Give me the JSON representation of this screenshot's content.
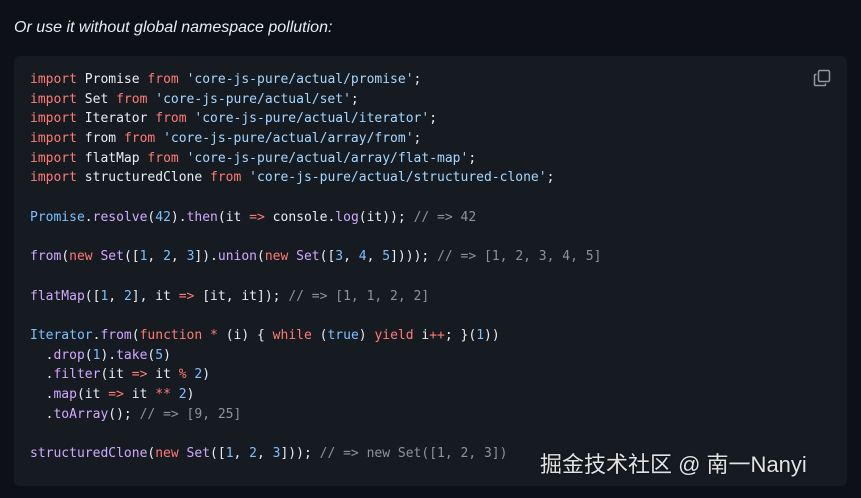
{
  "intro": "Or use it without global namespace pollution:",
  "copy_icon": "copy-icon",
  "colors": {
    "background": "#0d1117",
    "code_background": "#161b22",
    "keyword": "#ff7b72",
    "string": "#a5d6ff",
    "function": "#d2a8ff",
    "constant": "#79c0ff",
    "comment": "#8b949e",
    "text": "#e6edf3"
  },
  "code_lines": [
    [
      [
        "kw",
        "import"
      ],
      [
        "p",
        " Promise "
      ],
      [
        "kw",
        "from"
      ],
      [
        "p",
        " "
      ],
      [
        "str",
        "'core-js-pure/actual/promise'"
      ],
      [
        "p",
        ";"
      ]
    ],
    [
      [
        "kw",
        "import"
      ],
      [
        "p",
        " Set "
      ],
      [
        "kw",
        "from"
      ],
      [
        "p",
        " "
      ],
      [
        "str",
        "'core-js-pure/actual/set'"
      ],
      [
        "p",
        ";"
      ]
    ],
    [
      [
        "kw",
        "import"
      ],
      [
        "p",
        " Iterator "
      ],
      [
        "kw",
        "from"
      ],
      [
        "p",
        " "
      ],
      [
        "str",
        "'core-js-pure/actual/iterator'"
      ],
      [
        "p",
        ";"
      ]
    ],
    [
      [
        "kw",
        "import"
      ],
      [
        "p",
        " from "
      ],
      [
        "kw",
        "from"
      ],
      [
        "p",
        " "
      ],
      [
        "str",
        "'core-js-pure/actual/array/from'"
      ],
      [
        "p",
        ";"
      ]
    ],
    [
      [
        "kw",
        "import"
      ],
      [
        "p",
        " flatMap "
      ],
      [
        "kw",
        "from"
      ],
      [
        "p",
        " "
      ],
      [
        "str",
        "'core-js-pure/actual/array/flat-map'"
      ],
      [
        "p",
        ";"
      ]
    ],
    [
      [
        "kw",
        "import"
      ],
      [
        "p",
        " structuredClone "
      ],
      [
        "kw",
        "from"
      ],
      [
        "p",
        " "
      ],
      [
        "str",
        "'core-js-pure/actual/structured-clone'"
      ],
      [
        "p",
        ";"
      ]
    ],
    [],
    [
      [
        "const",
        "Promise"
      ],
      [
        "p",
        "."
      ],
      [
        "fn",
        "resolve"
      ],
      [
        "p",
        "("
      ],
      [
        "const",
        "42"
      ],
      [
        "p",
        ")."
      ],
      [
        "fn",
        "then"
      ],
      [
        "p",
        "(it "
      ],
      [
        "kw",
        "=>"
      ],
      [
        "p",
        " console."
      ],
      [
        "fn",
        "log"
      ],
      [
        "p",
        "(it)); "
      ],
      [
        "cm",
        "// => 42"
      ]
    ],
    [],
    [
      [
        "fn",
        "from"
      ],
      [
        "p",
        "("
      ],
      [
        "kw",
        "new"
      ],
      [
        "p",
        " "
      ],
      [
        "fn",
        "Set"
      ],
      [
        "p",
        "(["
      ],
      [
        "const",
        "1"
      ],
      [
        "p",
        ", "
      ],
      [
        "const",
        "2"
      ],
      [
        "p",
        ", "
      ],
      [
        "const",
        "3"
      ],
      [
        "p",
        "])."
      ],
      [
        "fn",
        "union"
      ],
      [
        "p",
        "("
      ],
      [
        "kw",
        "new"
      ],
      [
        "p",
        " "
      ],
      [
        "fn",
        "Set"
      ],
      [
        "p",
        "(["
      ],
      [
        "const",
        "3"
      ],
      [
        "p",
        ", "
      ],
      [
        "const",
        "4"
      ],
      [
        "p",
        ", "
      ],
      [
        "const",
        "5"
      ],
      [
        "p",
        "]))); "
      ],
      [
        "cm",
        "// => [1, 2, 3, 4, 5]"
      ]
    ],
    [],
    [
      [
        "fn",
        "flatMap"
      ],
      [
        "p",
        "(["
      ],
      [
        "const",
        "1"
      ],
      [
        "p",
        ", "
      ],
      [
        "const",
        "2"
      ],
      [
        "p",
        "], it "
      ],
      [
        "kw",
        "=>"
      ],
      [
        "p",
        " [it, it]); "
      ],
      [
        "cm",
        "// => [1, 1, 2, 2]"
      ]
    ],
    [],
    [
      [
        "const",
        "Iterator"
      ],
      [
        "p",
        "."
      ],
      [
        "fn",
        "from"
      ],
      [
        "p",
        "("
      ],
      [
        "kw",
        "function"
      ],
      [
        "p",
        " "
      ],
      [
        "kw",
        "*"
      ],
      [
        "p",
        " (i) { "
      ],
      [
        "kw",
        "while"
      ],
      [
        "p",
        " ("
      ],
      [
        "const",
        "true"
      ],
      [
        "p",
        ") "
      ],
      [
        "kw",
        "yield"
      ],
      [
        "p",
        " i"
      ],
      [
        "kw",
        "++"
      ],
      [
        "p",
        "; }("
      ],
      [
        "const",
        "1"
      ],
      [
        "p",
        "))"
      ]
    ],
    [
      [
        "p",
        "  ."
      ],
      [
        "fn",
        "drop"
      ],
      [
        "p",
        "("
      ],
      [
        "const",
        "1"
      ],
      [
        "p",
        ")."
      ],
      [
        "fn",
        "take"
      ],
      [
        "p",
        "("
      ],
      [
        "const",
        "5"
      ],
      [
        "p",
        ")"
      ]
    ],
    [
      [
        "p",
        "  ."
      ],
      [
        "fn",
        "filter"
      ],
      [
        "p",
        "(it "
      ],
      [
        "kw",
        "=>"
      ],
      [
        "p",
        " it "
      ],
      [
        "kw",
        "%"
      ],
      [
        "p",
        " "
      ],
      [
        "const",
        "2"
      ],
      [
        "p",
        ")"
      ]
    ],
    [
      [
        "p",
        "  ."
      ],
      [
        "fn",
        "map"
      ],
      [
        "p",
        "(it "
      ],
      [
        "kw",
        "=>"
      ],
      [
        "p",
        " it "
      ],
      [
        "kw",
        "**"
      ],
      [
        "p",
        " "
      ],
      [
        "const",
        "2"
      ],
      [
        "p",
        ")"
      ]
    ],
    [
      [
        "p",
        "  ."
      ],
      [
        "fn",
        "toArray"
      ],
      [
        "p",
        "(); "
      ],
      [
        "cm",
        "// => [9, 25]"
      ]
    ],
    [],
    [
      [
        "fn",
        "structuredClone"
      ],
      [
        "p",
        "("
      ],
      [
        "kw",
        "new"
      ],
      [
        "p",
        " "
      ],
      [
        "fn",
        "Set"
      ],
      [
        "p",
        "(["
      ],
      [
        "const",
        "1"
      ],
      [
        "p",
        ", "
      ],
      [
        "const",
        "2"
      ],
      [
        "p",
        ", "
      ],
      [
        "const",
        "3"
      ],
      [
        "p",
        "])); "
      ],
      [
        "cm",
        "// => new Set([1, 2, 3])"
      ]
    ]
  ],
  "watermark": "掘金技术社区 @ 南一Nanyi"
}
